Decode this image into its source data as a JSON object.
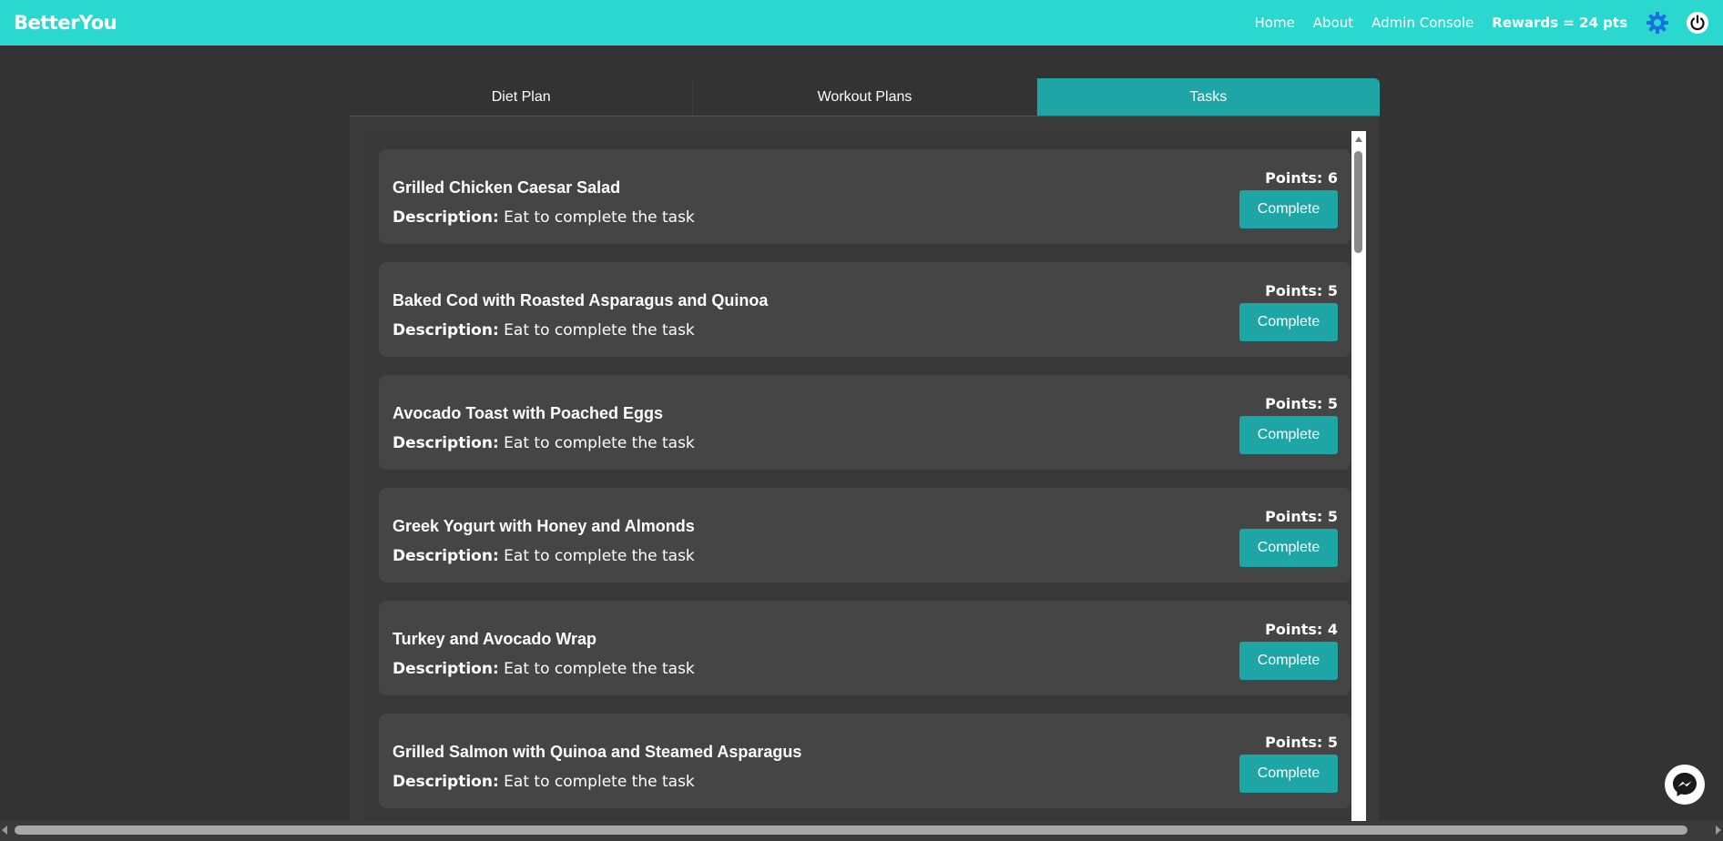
{
  "navbar": {
    "brand": "BetterYou",
    "links": [
      "Home",
      "About",
      "Admin Console"
    ],
    "rewards": "Rewards = 24 pts",
    "icons": [
      "gear-icon",
      "power-icon"
    ],
    "color": "#2ad8cf"
  },
  "tabs": [
    {
      "label": "Diet Plan",
      "active": false
    },
    {
      "label": "Workout Plans",
      "active": false
    },
    {
      "label": "Tasks",
      "active": true
    }
  ],
  "tasks": [
    {
      "name": "Grilled Chicken Caesar Salad",
      "description_label": "Description:",
      "description": "Eat to complete the task",
      "points": "Points: 6",
      "button": "Complete"
    },
    {
      "name": "Baked Cod with Roasted Asparagus and Quinoa",
      "description_label": "Description:",
      "description": "Eat to complete the task",
      "points": "Points: 5",
      "button": "Complete"
    },
    {
      "name": "Avocado Toast with Poached Eggs",
      "description_label": "Description:",
      "description": "Eat to complete the task",
      "points": "Points: 5",
      "button": "Complete"
    },
    {
      "name": "Greek Yogurt with Honey and Almonds",
      "description_label": "Description:",
      "description": "Eat to complete the task",
      "points": "Points: 5",
      "button": "Complete"
    },
    {
      "name": "Turkey and Avocado Wrap",
      "description_label": "Description:",
      "description": "Eat to complete the task",
      "points": "Points: 4",
      "button": "Complete"
    },
    {
      "name": "Grilled Salmon with Quinoa and Steamed Asparagus",
      "description_label": "Description:",
      "description": "Eat to complete the task",
      "points": "Points: 5",
      "button": "Complete"
    }
  ],
  "colors": {
    "accent": "#1ea6a7",
    "background": "#333333",
    "card": "#454545"
  },
  "chat_icon": "messenger-icon"
}
